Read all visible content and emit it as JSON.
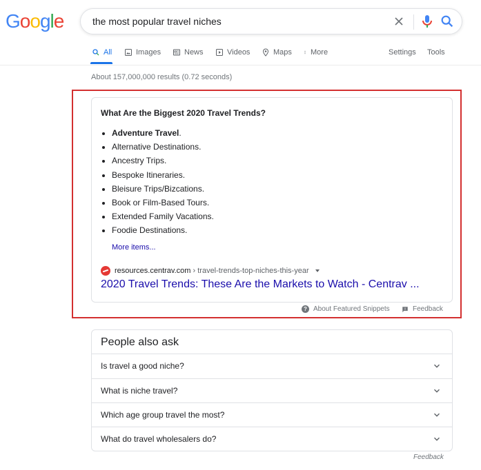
{
  "logo": {
    "letters": [
      "G",
      "o",
      "o",
      "g",
      "l",
      "e"
    ]
  },
  "search": {
    "query": "the most popular travel niches"
  },
  "tabs": [
    {
      "label": "All",
      "icon": "search-icon"
    },
    {
      "label": "Images",
      "icon": "image-icon"
    },
    {
      "label": "News",
      "icon": "news-icon"
    },
    {
      "label": "Videos",
      "icon": "video-icon"
    },
    {
      "label": "Maps",
      "icon": "map-pin-icon"
    },
    {
      "label": "More",
      "icon": "more-vert-icon"
    }
  ],
  "tools": {
    "settings": "Settings",
    "tools": "Tools"
  },
  "stats": "About 157,000,000 results (0.72 seconds)",
  "snippet": {
    "title": "What Are the Biggest 2020 Travel Trends?",
    "items": [
      {
        "text": "Adventure Travel",
        "suffix": "."
      },
      {
        "text": "Alternative Destinations."
      },
      {
        "text": "Ancestry Trips."
      },
      {
        "text": "Bespoke Itineraries."
      },
      {
        "text": "Bleisure Trips/Bizcations."
      },
      {
        "text": "Book or Film-Based Tours."
      },
      {
        "text": "Extended Family Vacations."
      },
      {
        "text": "Foodie Destinations."
      }
    ],
    "more_items": "More items...",
    "site": "resources.centrav.com",
    "path": " › travel-trends-top-niches-this-year",
    "link": "2020 Travel Trends: These Are the Markets to Watch - Centrav ..."
  },
  "snippet_footer": {
    "about": "About Featured Snippets",
    "feedback": "Feedback"
  },
  "paa": {
    "title": "People also ask",
    "questions": [
      "Is travel a good niche?",
      "What is niche travel?",
      "Which age group travel the most?",
      "What do travel wholesalers do?"
    ]
  },
  "bottom_feedback": "Feedback",
  "colors": {
    "accent": "#1a73e8",
    "link": "#1a0dab",
    "highlight": "#d32f2f"
  }
}
